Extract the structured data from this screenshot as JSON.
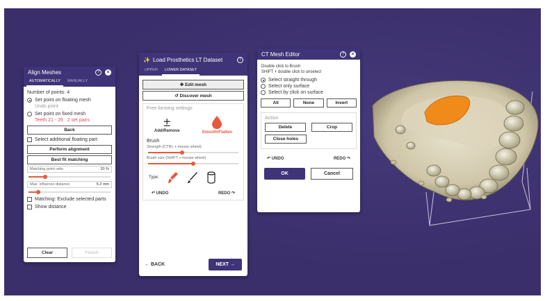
{
  "align": {
    "title": "Align Meshes",
    "tabs": [
      "AUTOMATICALLY",
      "MANUALLY"
    ],
    "points_label": "Number of points: 4",
    "radio1": "Set point on floating mesh",
    "radio1_sub": "Undo point",
    "radio2": "Set point on fixed mesh",
    "radio2_sub": "Teeth 21 - 26 : 2 set pairs",
    "back_btn": "Back",
    "check_floating": "Select additional floating part",
    "perform_btn": "Perform alignment",
    "bestfit_btn": "Best fit matching",
    "matching_label": "Matching point ratio",
    "matching_value": "20 %",
    "matching_pct": 0.2,
    "influence_label": "Max. influence distance",
    "influence_value": "5.2 mm",
    "influence_pct": 0.12,
    "check_exclude": "Matching: Exclude selected parts",
    "check_distance": "Show distance",
    "clear_btn": "Clear",
    "finish_btn": "Finish"
  },
  "prosthetics": {
    "title": "Load Prosthetics LT Dataset",
    "tabs": [
      "UPPER",
      "LOWER DATASET"
    ],
    "edit_btn": "Edit mesh",
    "discover_btn": "Discover mesh",
    "freeform_label": "Free forming settings",
    "add_label": "Add/Remove",
    "smooth_label": "Smooth/Flatten",
    "brush_label": "Brush",
    "strength_label": "Strength (CTRL + mouse wheel)",
    "strength_pct": 0.38,
    "size_label": "Brush size (SHIFT + mouse wheel)",
    "size_pct": 0.5,
    "type_label": "Type:",
    "undo": "UNDO",
    "redo": "REDO",
    "back": "BACK",
    "next": "NEXT"
  },
  "ct": {
    "title": "CT Mesh Editor",
    "hint1": "Double click to Brush",
    "hint2": "SHIFT + double click to unselect",
    "opt1": "Select straight through",
    "opt2": "Select only surface",
    "opt3": "Select by click on surface",
    "all": "All",
    "none": "None",
    "invert": "Invert",
    "action_label": "Action",
    "delete": "Delete",
    "crop": "Crop",
    "close_holes": "Close holes",
    "undo": "UNDO",
    "redo": "REDO",
    "ok": "OK",
    "cancel": "Cancel"
  },
  "colors": {
    "background": "#3a2f6b",
    "accent": "#3f3478",
    "orange": "#e8593a",
    "highlight": "#f08a1a"
  }
}
